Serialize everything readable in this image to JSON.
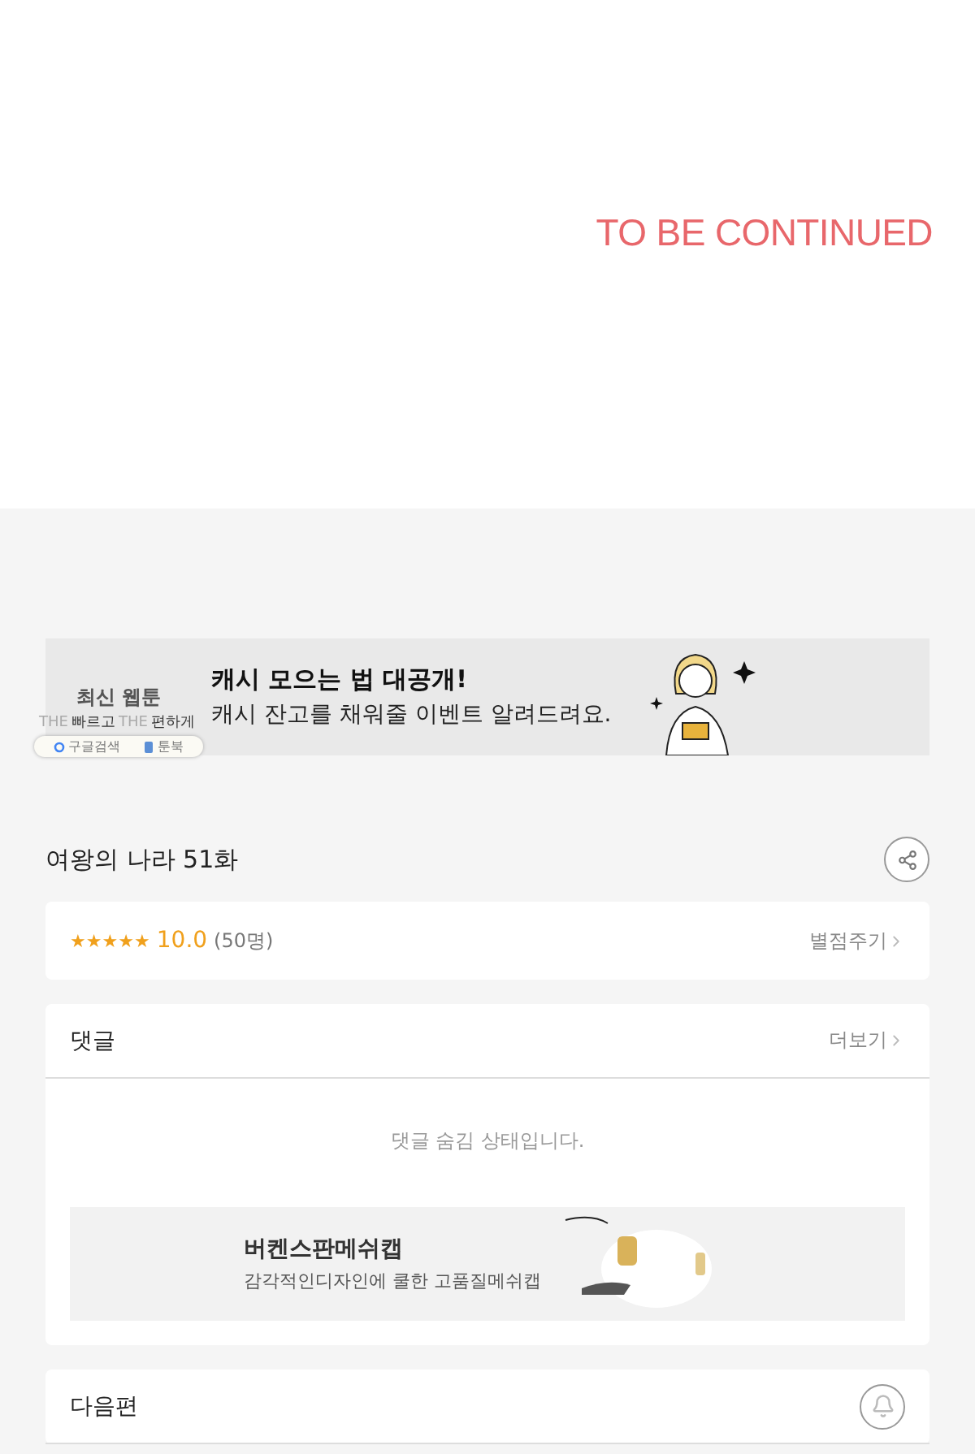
{
  "comic_panel": {
    "caption": "TO BE CONTINUED"
  },
  "promo_banner": {
    "badge_title": "최신 웹툰",
    "badge_slogan": [
      "THE",
      "빠르고",
      "THE",
      "편하게"
    ],
    "badge_links": [
      "구글검색",
      "툰북"
    ],
    "headline": "캐시 모으는 법 대공개!",
    "subline": "캐시 잔고를 채워줄 이벤트 알려드려요."
  },
  "episode": {
    "title": "여왕의 나라 51화"
  },
  "rating": {
    "stars": 5,
    "score": "10.0",
    "count": "(50명)",
    "action": "별점주기"
  },
  "comments": {
    "title": "댓글",
    "more": "더보기",
    "notice": "댓글 숨김 상태입니다.",
    "ad": {
      "title": "버켄스판메쉬캡",
      "subtitle": "감각적인디자인에 쿨한 고품질메쉬캡"
    }
  },
  "next_episode": {
    "title": "다음편"
  }
}
